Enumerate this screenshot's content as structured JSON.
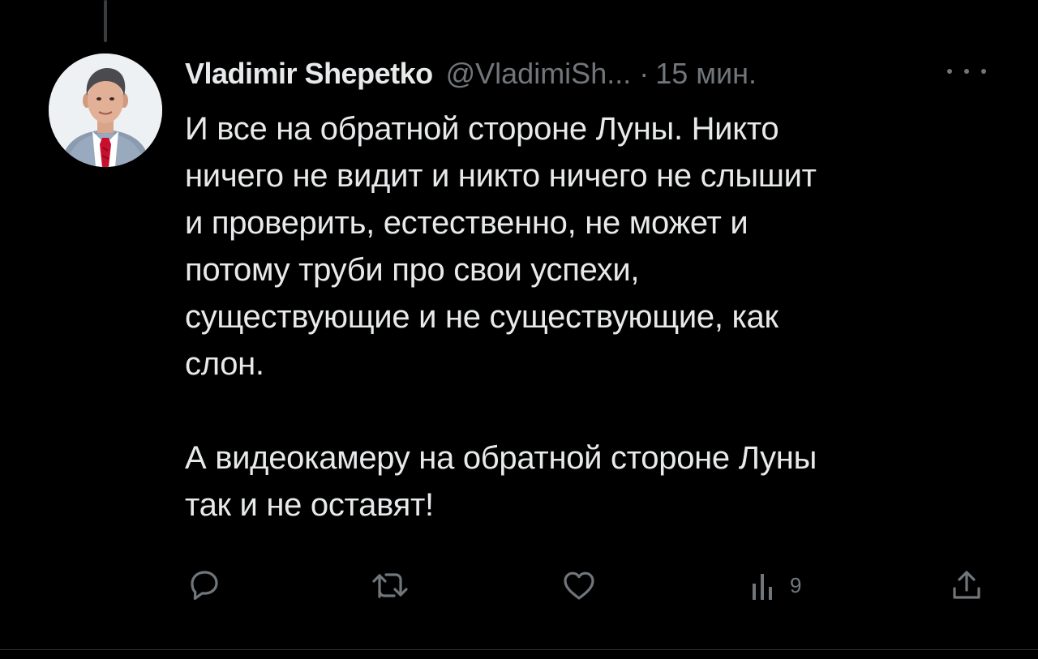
{
  "tweet": {
    "author_name": "Vladimir Shepetko",
    "author_handle": "@VladimiSh...",
    "separator": "·",
    "time": "15 мин.",
    "paragraphs": [
      "И все на обратной стороне Луны. Никто\nничего не видит и никто ничего не слышит\nи проверить, естественно, не может и\nпотому труби про свои успехи,\nсуществующие и не существующие, как\nслон.",
      "А видеокамеру на обратной стороне Луны\nтак и не оставят!"
    ]
  },
  "actions": {
    "reply": {
      "icon": "reply-icon"
    },
    "repost": {
      "icon": "repost-icon"
    },
    "like": {
      "icon": "heart-icon"
    },
    "views": {
      "icon": "views-icon",
      "count": "9"
    },
    "share": {
      "icon": "share-icon"
    }
  },
  "colors": {
    "background": "#000000",
    "text_primary": "#e7e9ea",
    "text_secondary": "#71767b",
    "thread_line": "#3a3d40"
  }
}
